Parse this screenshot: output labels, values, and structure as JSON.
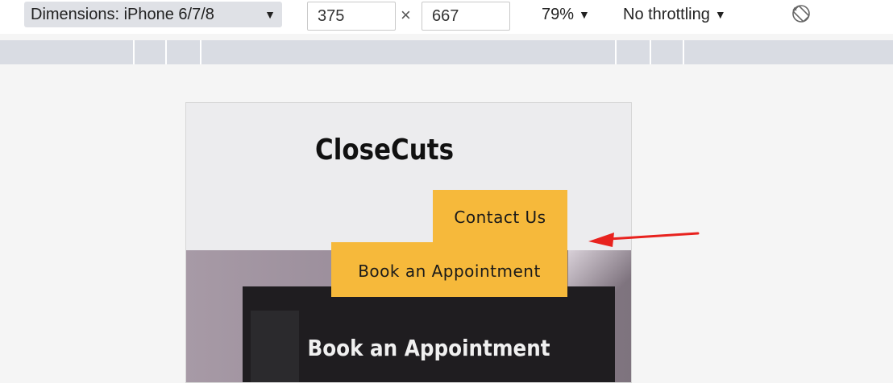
{
  "devtools": {
    "dimensions_label": "Dimensions: iPhone 6/7/8",
    "width_value": "375",
    "times_symbol": "×",
    "height_value": "667",
    "zoom_label": "79%",
    "throttle_label": "No throttling",
    "caret": "▼",
    "icons": {
      "rotate": "rotate-icon"
    }
  },
  "site": {
    "brand": "CloseCuts",
    "nav": {
      "contact_label": "Contact Us",
      "book_label": "Book an Appointment"
    },
    "hero": {
      "title": "Book an Appointment"
    }
  },
  "colors": {
    "button_bg": "#f6b93b",
    "arrow": "#e8221e",
    "toolbar_select_bg": "#dfe1e6",
    "ruler": "#d9dce3"
  }
}
